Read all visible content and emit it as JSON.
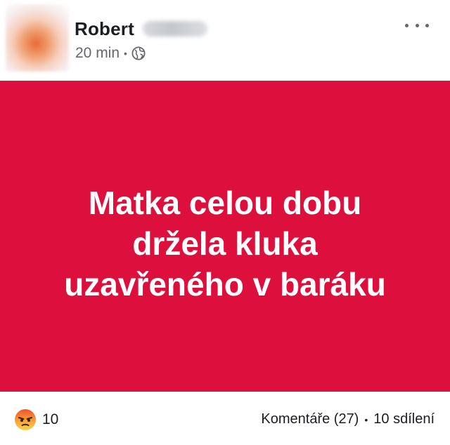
{
  "post": {
    "author": {
      "first_name": "Robert",
      "surname_redacted": true
    },
    "meta": {
      "time": "20 min",
      "separator": "•",
      "audience_icon": "globe-icon"
    },
    "more_icon": "more-horizontal-icon",
    "banner": {
      "background_color": "#dc0f3d",
      "text_color": "#ffffff",
      "lines": [
        "Matka celou dobu",
        "držela kluka",
        "uzavřeného v baráku"
      ]
    },
    "footer": {
      "reaction_icon": "angry-reaction-icon",
      "reaction_count": "10",
      "comments_label": "Komentáře (27)",
      "separator": "•",
      "shares_label": "10 sdílení"
    }
  }
}
